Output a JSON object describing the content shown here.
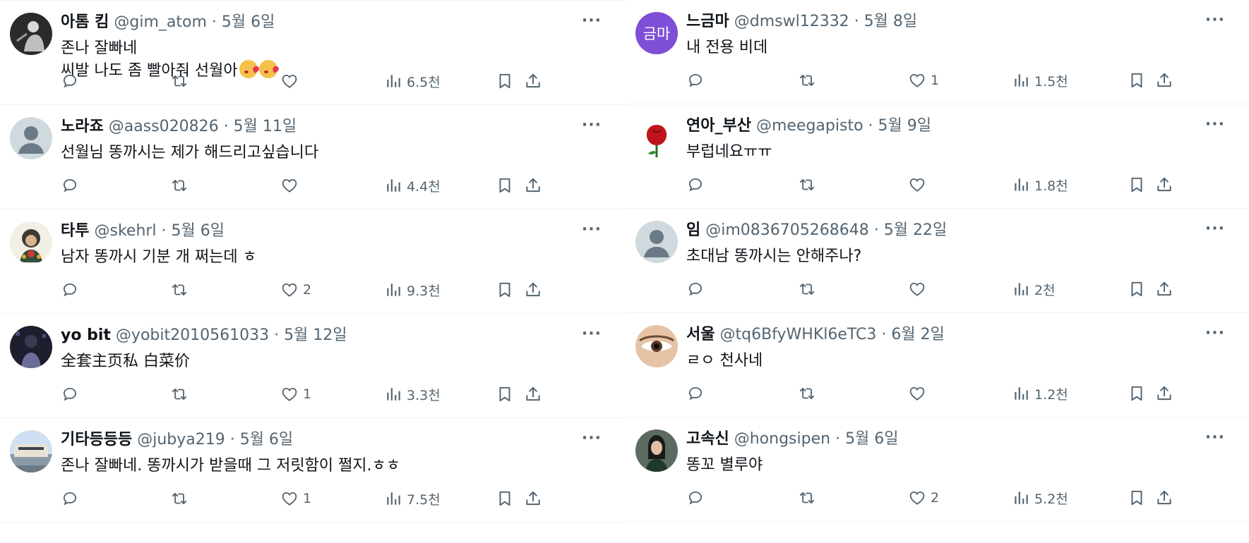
{
  "left": [
    {
      "name": "아톰 킴",
      "handle": "@gim_atom",
      "date": "5월 6일",
      "text": "존나 잘빠네\n씨발 나도 좀 빨아줘 선월아",
      "emojis": 2,
      "replies": "",
      "retweets": "",
      "likes": "",
      "views": "6.5천",
      "avatar": "photo-dark"
    },
    {
      "name": "노라죠",
      "handle": "@aass020826",
      "date": "5월 11일",
      "text": "선월님 똥까시는 제가 해드리고싶습니다",
      "emojis": 0,
      "replies": "",
      "retweets": "",
      "likes": "",
      "views": "4.4천",
      "avatar": "default"
    },
    {
      "name": "타투",
      "handle": "@skehrl",
      "date": "5월 6일",
      "text": "남자 똥까시 기분 개 쩌는데 ㅎ",
      "emojis": 0,
      "replies": "",
      "retweets": "",
      "likes": "2",
      "views": "9.3천",
      "avatar": "photo-illustration"
    },
    {
      "name": "yo bit",
      "handle": "@yobit2010561033",
      "date": "5월 12일",
      "text": "全套主页私 白菜价",
      "emojis": 0,
      "replies": "",
      "retweets": "",
      "likes": "1",
      "views": "3.3천",
      "avatar": "photo-night"
    },
    {
      "name": "기타등등등",
      "handle": "@jubya219",
      "date": "5월 6일",
      "text": "존나 잘빠네. 똥까시가 받을때 그 저릿함이 쩔지.ㅎㅎ",
      "emojis": 0,
      "replies": "",
      "retweets": "",
      "likes": "1",
      "views": "7.5천",
      "avatar": "photo-building"
    }
  ],
  "right": [
    {
      "name": "느금마",
      "handle": "@dmswl12332",
      "date": "5월 8일",
      "text": "내 전용 비데",
      "emojis": 0,
      "replies": "",
      "retweets": "",
      "likes": "1",
      "views": "1.5천",
      "avatar": "initials",
      "initials": "금마",
      "avatar_color": "#7e4fd6"
    },
    {
      "name": "연아_부산",
      "handle": "@meegapisto",
      "date": "5월 9일",
      "text": "부럽네요ㅠㅠ",
      "emojis": 0,
      "replies": "",
      "retweets": "",
      "likes": "",
      "views": "1.8천",
      "avatar": "photo-rose"
    },
    {
      "name": "임",
      "handle": "@im0836705268648",
      "date": "5월 22일",
      "text": "초대남 똥까시는 안해주나?",
      "emojis": 0,
      "replies": "",
      "retweets": "",
      "likes": "",
      "views": "2천",
      "avatar": "default"
    },
    {
      "name": "서울",
      "handle": "@tq6BfyWHKl6eTC3",
      "date": "6월 2일",
      "text": "ㄹㅇ 천사네",
      "emojis": 0,
      "replies": "",
      "retweets": "",
      "likes": "",
      "views": "1.2천",
      "avatar": "photo-eye"
    },
    {
      "name": "고속신",
      "handle": "@hongsipen",
      "date": "5월 6일",
      "text": "똥꼬 별루야",
      "emojis": 0,
      "replies": "",
      "retweets": "",
      "likes": "2",
      "views": "5.2천",
      "avatar": "photo-woman"
    }
  ],
  "ui": {
    "separator": " · ",
    "more": "···"
  },
  "colors": {
    "meta": "#536471",
    "text": "#0f1419",
    "divider": "#eff3f4"
  }
}
